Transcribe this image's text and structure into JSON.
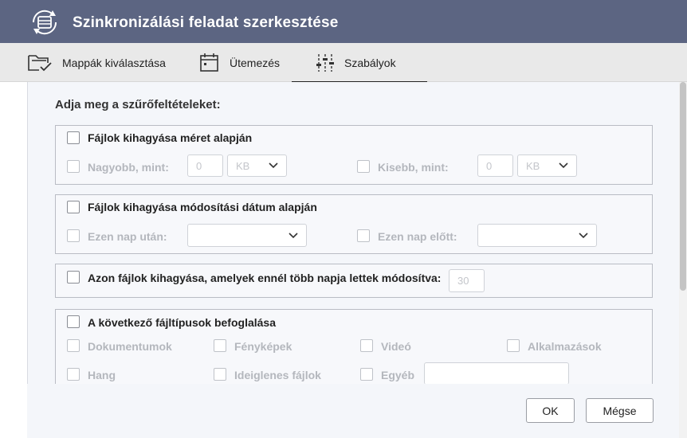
{
  "window": {
    "title": "Szinkronizálási feladat szerkesztése",
    "app_icon": "sync-drive-icon"
  },
  "tabs": [
    {
      "label": "Mappák kiválasztása",
      "icon": "folder-check-icon",
      "active": false
    },
    {
      "label": "Ütemezés",
      "icon": "calendar-icon",
      "active": false
    },
    {
      "label": "Szabályok",
      "icon": "sliders-icon",
      "active": true
    }
  ],
  "filters": {
    "heading": "Adja meg a szűrőfeltételeket:",
    "size": {
      "label": "Fájlok kihagyása méret alapján",
      "larger_label": "Nagyobb, mint:",
      "larger_value": "0",
      "larger_unit": "KB",
      "smaller_label": "Kisebb, mint:",
      "smaller_value": "0",
      "smaller_unit": "KB"
    },
    "date": {
      "label": "Fájlok kihagyása módosítási dátum alapján",
      "after_label": "Ezen nap után:",
      "after_value": "",
      "before_label": "Ezen nap előtt:",
      "before_value": ""
    },
    "days": {
      "label": "Azon fájlok kihagyása, amelyek ennél több napja lettek módosítva:",
      "value": "30"
    },
    "types": {
      "label": "A következő fájltípusok befoglalása",
      "documents": "Dokumentumok",
      "photos": "Fényképek",
      "video": "Videó",
      "apps": "Alkalmazások",
      "audio": "Hang",
      "temp": "Ideiglenes fájlok",
      "other": "Egyéb",
      "other_value": ""
    }
  },
  "buttons": {
    "ok": "OK",
    "cancel": "Mégse"
  },
  "colors": {
    "titlebar": "#5c6582",
    "tabbar": "#e9e9e9",
    "content_bg": "#f4f6fa",
    "disabled_text": "#b4b7bd"
  }
}
